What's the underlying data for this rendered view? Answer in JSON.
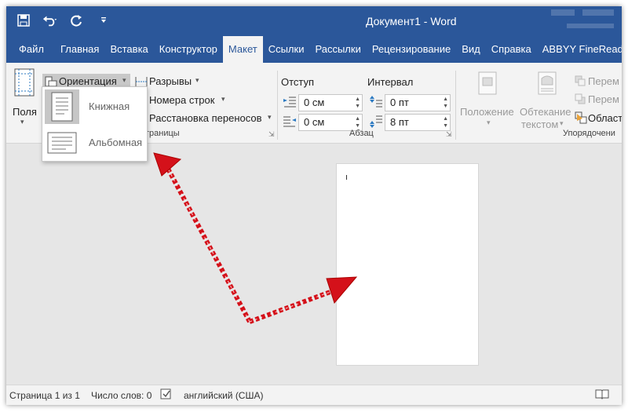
{
  "titlebar": {
    "title": "Документ1  -  Word",
    "bg": "#2b579a"
  },
  "tabs": [
    "Файл",
    "Главная",
    "Вставка",
    "Конструктор",
    "Макет",
    "Ссылки",
    "Рассылки",
    "Рецензирование",
    "Вид",
    "Справка",
    "ABBYY FineReade"
  ],
  "active_tab": "Макет",
  "ribbon": {
    "margins_label": "Поля",
    "orientation_label": "Ориентация",
    "breaks_label": "Разрывы",
    "line_numbers_label": "Номера строк",
    "hyphenation_label": "Расстановка переносов",
    "page_setup_group_label": "границы",
    "indent_label": "Отступ",
    "spacing_label": "Интервал",
    "indent_left": "0 см",
    "indent_right": "0 см",
    "spacing_before": "0 пт",
    "spacing_after": "8 пт",
    "paragraph_group_label": "Абзац",
    "position_label": "Положение",
    "wrap_text_label_1": "Обтекание",
    "wrap_text_label_2": "текстом",
    "bring_forward_label": "Перем",
    "send_backward_label": "Перем",
    "selection_pane_label": "Област",
    "arrange_group_label": "Упорядочени"
  },
  "orientation_menu": {
    "portrait": "Книжная",
    "landscape": "Альбомная",
    "selected": "portrait"
  },
  "statusbar": {
    "page": "Страница 1 из 1",
    "words": "Число слов: 0",
    "language": "английский (США)"
  },
  "icons": [
    "save-icon",
    "undo-icon",
    "redo-icon",
    "customize-qat-icon",
    "margins-icon",
    "orientation-icon",
    "breaks-icon",
    "line-numbers-icon",
    "hyphenation-icon",
    "indent-left-icon",
    "indent-right-icon",
    "spacing-before-icon",
    "spacing-after-icon",
    "position-icon",
    "wrap-text-icon",
    "selection-pane-icon",
    "portrait-icon",
    "landscape-icon",
    "proofing-icon",
    "read-mode-icon",
    "annotation-arrow-icon"
  ],
  "colors": {
    "accent": "#2b579a",
    "arrow": "#d4111a"
  }
}
